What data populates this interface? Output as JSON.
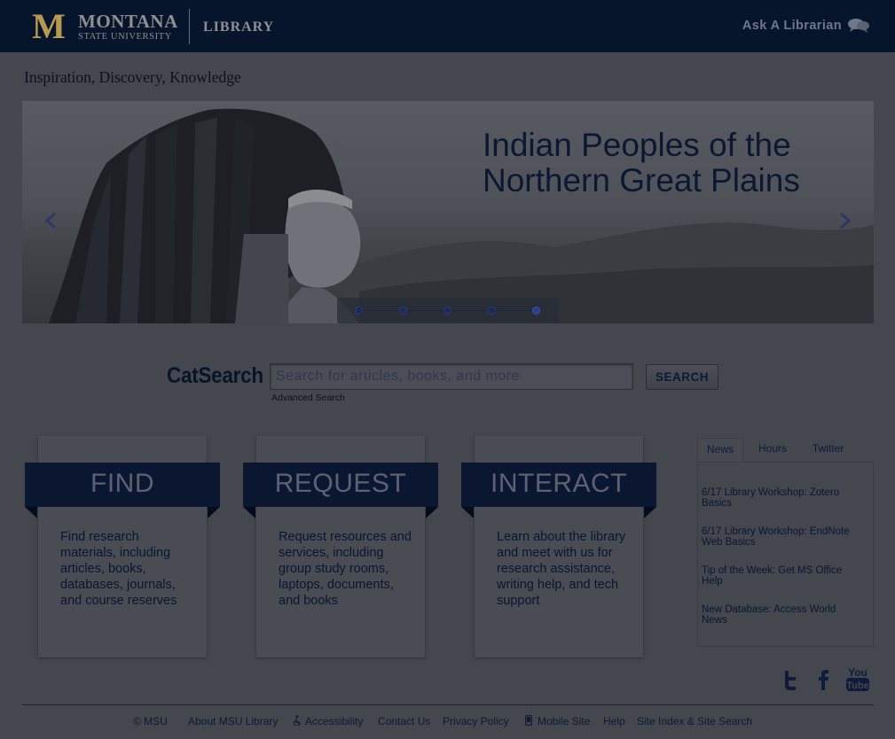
{
  "header": {
    "logo_mark": "M",
    "logo_name": "MONTANA",
    "logo_sub": "STATE UNIVERSITY",
    "logo_library": "LIBRARY",
    "ask_label": "Ask A Librarian"
  },
  "tagline": "Inspiration, Discovery, Knowledge",
  "hero": {
    "title": "Indian Peoples of the Northern Great Plains",
    "slides_total": 5,
    "slide_active": 5
  },
  "search": {
    "label": "CatSearch",
    "placeholder": "Search for articles, books, and more",
    "button": "SEARCH",
    "advanced": "Advanced Search"
  },
  "cards": [
    {
      "title": "FIND",
      "text": "Find research materials, including articles, books, databases, journals, and course reserves"
    },
    {
      "title": "REQUEST",
      "text": "Request resources and services, including group study rooms, laptops, documents, and books"
    },
    {
      "title": "INTERACT",
      "text": "Learn about the library and meet with us for research assistance, writing help, and tech support"
    }
  ],
  "tabs": {
    "items": [
      "News",
      "Hours",
      "Twitter"
    ],
    "active": "News",
    "news": [
      "6/17 Library Workshop: Zotero Basics",
      "6/17 Library Workshop: EndNote Web Basics",
      "Tip of the Week: Get MS Office Help",
      "New Database: Access World News"
    ]
  },
  "social": {
    "youtube_top": "You",
    "youtube_bottom": "Tube"
  },
  "footer": {
    "copyright": "© MSU",
    "links": [
      "About MSU Library",
      "Accessibility",
      "Contact Us",
      "Privacy Policy",
      "Mobile Site",
      "Help",
      "Site Index & Site Search"
    ]
  },
  "colors": {
    "header_bg": "#06142c",
    "page_bg": "#45474f",
    "banner_bg": "#0b1631",
    "gold": "#b79a50"
  }
}
